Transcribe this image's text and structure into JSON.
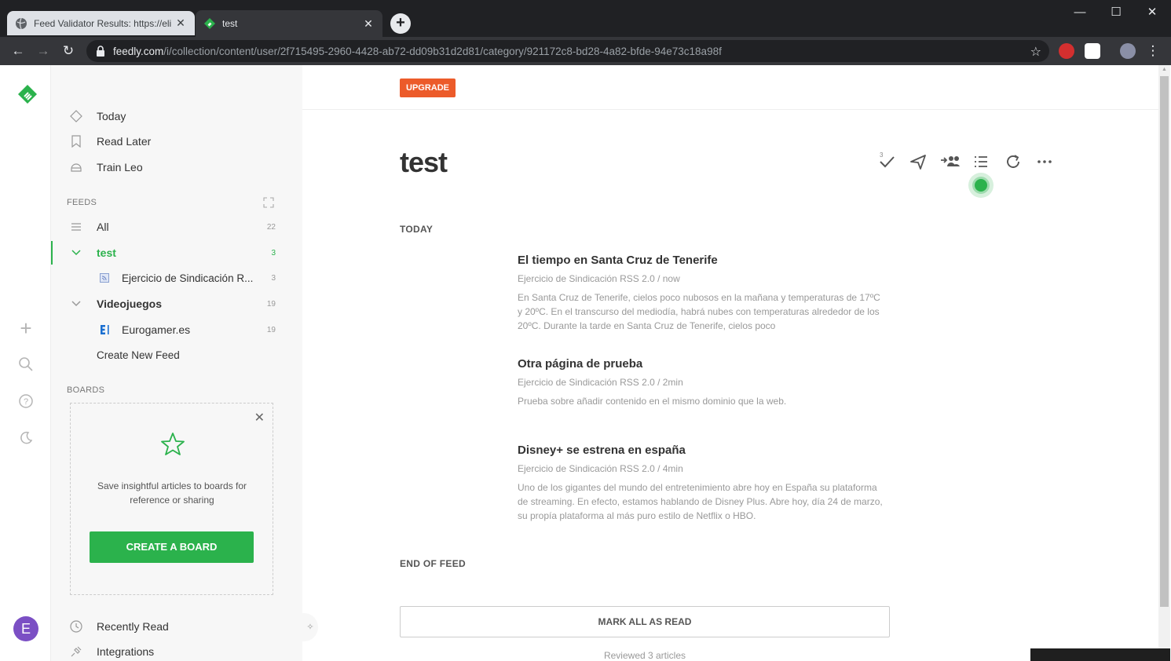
{
  "browser": {
    "tabs": [
      {
        "title": "Feed Validator Results: https://eli",
        "active": false
      },
      {
        "title": "test",
        "active": true
      }
    ],
    "url_host": "feedly.com",
    "url_path": "/i/collection/content/user/2f715495-2960-4428-ab72-dd09b31d2d81/category/921172c8-bd28-4a82-bfde-94e73c18a98f",
    "window_controls": [
      "minimize",
      "maximize",
      "close"
    ]
  },
  "colors": {
    "accent_green": "#2bb24c",
    "upgrade_orange": "#ec5b2a",
    "avatar_purple": "#7b4fc4"
  },
  "rail": {
    "avatar_letter": "E",
    "icons": [
      "feedly-logo-icon",
      "add-icon",
      "search-icon",
      "help-icon",
      "night-mode-icon"
    ]
  },
  "sidebar": {
    "top_items": [
      {
        "label": "Today",
        "icon": "today-icon"
      },
      {
        "label": "Read Later",
        "icon": "bookmark-icon"
      },
      {
        "label": "Train Leo",
        "icon": "leo-icon"
      }
    ],
    "feeds_title": "FEEDS",
    "feeds": [
      {
        "label": "All",
        "count": "22"
      },
      {
        "label": "test",
        "count": "3"
      },
      {
        "label": "Ejercicio de Sindicación R...",
        "count": "3"
      },
      {
        "label": "Videojuegos",
        "count": "19"
      },
      {
        "label": "Eurogamer.es",
        "count": "19"
      }
    ],
    "create_feed": "Create New Feed",
    "boards_title": "BOARDS",
    "board_card": {
      "text": "Save insightful articles to boards for reference or sharing",
      "button": "CREATE A BOARD"
    },
    "bottom_items": [
      {
        "label": "Recently Read"
      },
      {
        "label": "Integrations"
      }
    ]
  },
  "main": {
    "upgrade": "UPGRADE",
    "title": "test",
    "mark_read_count": "3",
    "section_today": "TODAY",
    "articles": [
      {
        "title": "El tiempo en Santa Cruz de Tenerife",
        "meta": "Ejercicio de Sindicación RSS 2.0 / now",
        "summary": "En Santa Cruz de Tenerife, cielos poco nubosos en la mañana y temperaturas de 17ºC y 20ºC. En el transcurso del mediodía, habrá nubes con temperaturas alrededor de los 20ºC. Durante la tarde en Santa Cruz de Tenerife, cielos poco"
      },
      {
        "title": "Otra página de prueba",
        "meta": "Ejercicio de Sindicación RSS 2.0 / 2min",
        "summary": "Prueba sobre añadir contenido en el mismo dominio que la web."
      },
      {
        "title": "Disney+ se estrena en españa",
        "meta": "Ejercicio de Sindicación RSS 2.0 / 4min",
        "summary": "Uno de los gigantes del mundo del entretenimiento abre hoy en España su plataforma de streaming. En efecto, estamos hablando de Disney Plus. Abre hoy, día 24 de marzo, su propía plataforma al más puro estilo de Netflix o HBO."
      }
    ],
    "end_of_feed": "END OF FEED",
    "mark_all": "MARK ALL AS READ",
    "reviewed": "Reviewed 3 articles"
  }
}
